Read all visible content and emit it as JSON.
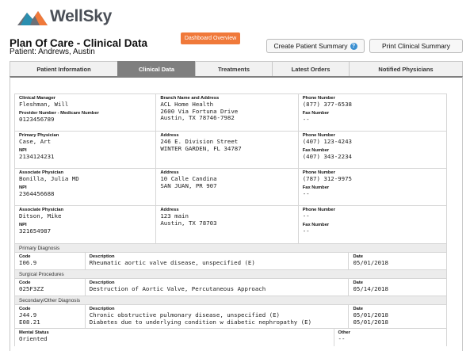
{
  "brand": {
    "name": "WellSky",
    "logo_icon": "mountain-logo-icon",
    "colors": [
      "#2a8fb0",
      "#f0793a",
      "#6c6f76"
    ]
  },
  "header": {
    "title": "Plan Of Care - Clinical Data",
    "patient": "Patient: Andrews, Austin",
    "dashboard_button": "Dashboard Overview",
    "create_summary_button": "Create Patient Summary",
    "print_button": "Print Clinical Summary"
  },
  "tabs": [
    {
      "label": "Patient Information",
      "active": false
    },
    {
      "label": "Clinical Data",
      "active": true
    },
    {
      "label": "Treatments",
      "active": false
    },
    {
      "label": "Latest Orders",
      "active": false
    },
    {
      "label": "Notified Physicians",
      "active": false
    }
  ],
  "rows": [
    {
      "c1": [
        {
          "label": "Clinical Manager",
          "value": "Fleshman, Will"
        },
        {
          "label": "Provider Number - Medicare Number",
          "value": "0123456789"
        }
      ],
      "c2": [
        {
          "label": "Branch Name and Address",
          "value": "ACL Home Health\n2600 Via Fortuna Drive\nAustin, TX 78746-7982"
        }
      ],
      "c3": [
        {
          "label": "Phone Number",
          "value": "(877) 377-6538"
        },
        {
          "label": "Fax Number",
          "value": "--"
        }
      ]
    },
    {
      "c1": [
        {
          "label": "Primary Physician",
          "value": "Case, Art"
        },
        {
          "label": "NPI",
          "value": "2134124231"
        }
      ],
      "c2": [
        {
          "label": "Address",
          "value": "246 E. Division Street\nWINTER GARDEN, FL 34787"
        }
      ],
      "c3": [
        {
          "label": "Phone Number",
          "value": "(407) 123-4243"
        },
        {
          "label": "Fax Number",
          "value": "(407) 343-2234"
        }
      ]
    },
    {
      "c1": [
        {
          "label": "Associate Physician",
          "value": "Bonilla, Julia MD"
        },
        {
          "label": "NPI",
          "value": "2364456688"
        }
      ],
      "c2": [
        {
          "label": "Address",
          "value": "10 Calle Candina\nSAN JUAN, PR 907"
        }
      ],
      "c3": [
        {
          "label": "Phone Number",
          "value": "(787) 312-9975"
        },
        {
          "label": "Fax Number",
          "value": "--"
        }
      ]
    },
    {
      "c1": [
        {
          "label": "Associate Physician",
          "value": "Ditson, Mike"
        },
        {
          "label": "NPI",
          "value": "321654987"
        }
      ],
      "c2": [
        {
          "label": "Address",
          "value": "123 main\nAustin, TX 78703"
        }
      ],
      "c3": [
        {
          "label": "Phone Number",
          "value": "--"
        },
        {
          "label": "Fax Number",
          "value": "--"
        }
      ]
    }
  ],
  "col_labels": {
    "code": "Code",
    "description": "Description",
    "date": "Date"
  },
  "primary_diagnosis": {
    "heading": "Primary Diagnosis",
    "code": "I06.9",
    "description": "Rheumatic aortic valve disease, unspecified (E)",
    "date": "05/01/2018"
  },
  "surgical_procedures": {
    "heading": "Surgical Procedures",
    "code": "025F3ZZ",
    "description": "Destruction of Aortic Valve, Percutaneous Approach",
    "date": "05/14/2018"
  },
  "secondary_diagnosis": {
    "heading": "Secondary/Other Diagnosis",
    "code": "J44.9\nE08.21",
    "description": "Chronic obstructive pulmonary disease, unspecified (E)\nDiabetes due to underlying condition w diabetic nephropathy (E)",
    "date": "05/01/2018\n05/01/2018"
  },
  "mental_status": {
    "label": "Mental Status",
    "value": "Oriented",
    "other_label": "Other",
    "other_value": "--"
  }
}
